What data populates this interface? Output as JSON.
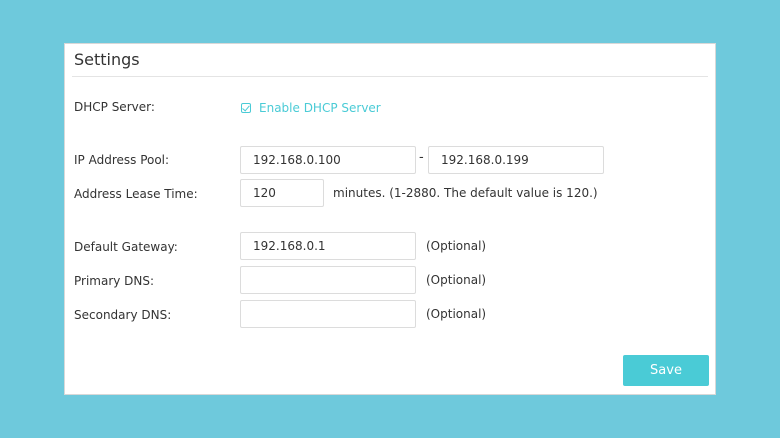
{
  "panel": {
    "title": "Settings"
  },
  "dhcp": {
    "label": "DHCP Server:",
    "checkbox_label": "Enable DHCP Server",
    "checked": true
  },
  "ip_pool": {
    "label": "IP Address Pool:",
    "start": "192.168.0.100",
    "separator": "-",
    "end": "192.168.0.199"
  },
  "lease": {
    "label": "Address Lease Time:",
    "value": "120",
    "hint": "minutes. (1-2880. The default value is 120.)"
  },
  "gateway": {
    "label": "Default Gateway:",
    "value": "192.168.0.1",
    "hint": "(Optional)"
  },
  "primary_dns": {
    "label": "Primary DNS:",
    "value": "",
    "hint": "(Optional)"
  },
  "secondary_dns": {
    "label": "Secondary DNS:",
    "value": "",
    "hint": "(Optional)"
  },
  "save_label": "Save",
  "colors": {
    "background": "#6ec9dc",
    "accent": "#4acbd6",
    "text": "#333333",
    "panel": "#ffffff"
  }
}
